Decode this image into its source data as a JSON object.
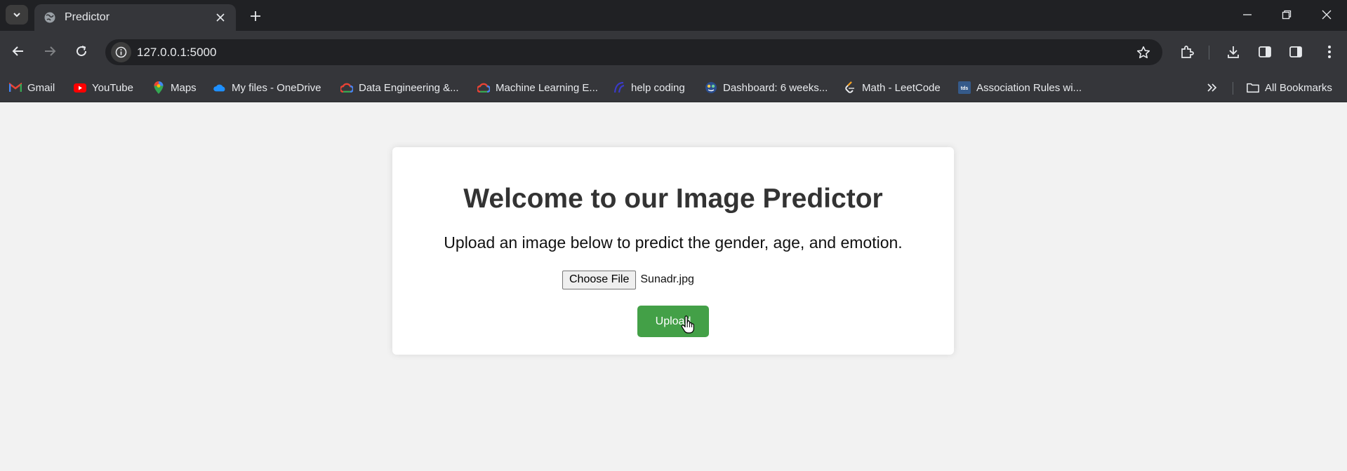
{
  "browser": {
    "tab_title": "Predictor",
    "url": "127.0.0.1:5000",
    "bookmarks": [
      {
        "label": "Gmail",
        "icon": "gmail-icon"
      },
      {
        "label": "YouTube",
        "icon": "youtube-icon"
      },
      {
        "label": "Maps",
        "icon": "maps-icon"
      },
      {
        "label": "My files - OneDrive",
        "icon": "onedrive-icon"
      },
      {
        "label": "Data Engineering &...",
        "icon": "google-cloud-icon"
      },
      {
        "label": "Machine Learning E...",
        "icon": "google-cloud-icon"
      },
      {
        "label": "help coding",
        "icon": "help-coding-icon"
      },
      {
        "label": "Dashboard: 6 weeks...",
        "icon": "dashboard-icon"
      },
      {
        "label": "Math - LeetCode",
        "icon": "leetcode-icon"
      },
      {
        "label": "Association Rules wi...",
        "icon": "tds-icon"
      }
    ],
    "all_bookmarks_label": "All Bookmarks"
  },
  "page": {
    "heading": "Welcome to our Image Predictor",
    "subtitle": "Upload an image below to predict the gender, age, and emotion.",
    "choose_file_label": "Choose File",
    "selected_file": "Sunadr.jpg",
    "upload_label": "Upload",
    "upload_color": "#43a047"
  }
}
